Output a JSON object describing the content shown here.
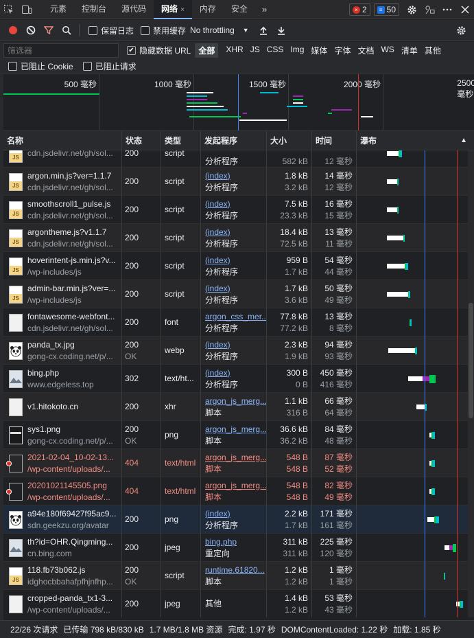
{
  "tabs": [
    {
      "label": "元素"
    },
    {
      "label": "控制台"
    },
    {
      "label": "源代码"
    },
    {
      "label": "网络",
      "active": true
    },
    {
      "label": "内存"
    },
    {
      "label": "安全"
    }
  ],
  "tab_close": "×",
  "more_tabs": "»",
  "errors_count": "2",
  "messages_count": "50",
  "toolbar": {
    "preserve_log": "保留日志",
    "disable_cache": "禁用缓存",
    "throttling": "No throttling"
  },
  "filter": {
    "placeholder": "筛选器",
    "hide_data_urls": "隐藏数据 URL",
    "types": [
      "全部",
      "XHR",
      "JS",
      "CSS",
      "Img",
      "媒体",
      "字体",
      "文档",
      "WS",
      "清单",
      "其他"
    ],
    "blocked_cookies": "已阻止 Cookie",
    "blocked_requests": "已阻止请求"
  },
  "overview": {
    "labels": [
      "500 毫秒",
      "1000 毫秒",
      "1500 毫秒",
      "2000 毫秒",
      "2500 毫秒"
    ]
  },
  "columns": {
    "name": "名称",
    "status": "状态",
    "type": "类型",
    "initiator": "发起程序",
    "size": "大小",
    "time": "时间",
    "waterfall": "瀑布"
  },
  "requests": [
    {
      "name": "",
      "domain": "cdn.jsdelivr.net/gh/sol...",
      "status": "200",
      "status2": "",
      "type": "script",
      "initiator": "",
      "initiator2": "分析程序",
      "size": "",
      "size2": "582 kB",
      "time": "",
      "time2": "12 毫秒",
      "icon": "js",
      "wf_start": 0.26,
      "wf_wait": 0.1,
      "wf_dl": 0.03
    },
    {
      "name": "argon.min.js?ver=1.1.7",
      "domain": "cdn.jsdelivr.net/gh/sol...",
      "status": "200",
      "status2": "",
      "type": "script",
      "initiator": "(index)",
      "initiator2": "分析程序",
      "size": "1.8 kB",
      "size2": "3.2 kB",
      "time": "14 毫秒",
      "time2": "12 毫秒",
      "icon": "js",
      "wf_start": 0.26,
      "wf_wait": 0.09,
      "wf_dl": 0.01
    },
    {
      "name": "smoothscroll1_pulse.js",
      "domain": "cdn.jsdelivr.net/gh/sol...",
      "status": "200",
      "status2": "",
      "type": "script",
      "initiator": "(index)",
      "initiator2": "分析程序",
      "size": "7.5 kB",
      "size2": "23.3 kB",
      "time": "16 毫秒",
      "time2": "15 毫秒",
      "icon": "js",
      "wf_start": 0.26,
      "wf_wait": 0.09,
      "wf_dl": 0.01
    },
    {
      "name": "argontheme.js?v1.1.7",
      "domain": "cdn.jsdelivr.net/gh/sol...",
      "status": "200",
      "status2": "",
      "type": "script",
      "initiator": "(index)",
      "initiator2": "分析程序",
      "size": "18.4 kB",
      "size2": "72.5 kB",
      "time": "13 毫秒",
      "time2": "11 毫秒",
      "icon": "js",
      "wf_start": 0.26,
      "wf_wait": 0.14,
      "wf_dl": 0.01
    },
    {
      "name": "hoverintent-js.min.js?v...",
      "domain": "/wp-includes/js",
      "status": "200",
      "status2": "",
      "type": "script",
      "initiator": "(index)",
      "initiator2": "分析程序",
      "size": "959 B",
      "size2": "1.7 kB",
      "time": "54 毫秒",
      "time2": "44 毫秒",
      "icon": "js",
      "wf_start": 0.26,
      "wf_wait": 0.15,
      "wf_dl": 0.03
    },
    {
      "name": "admin-bar.min.js?ver=...",
      "domain": "/wp-includes/js",
      "status": "200",
      "status2": "",
      "type": "script",
      "initiator": "(index)",
      "initiator2": "分析程序",
      "size": "1.7 kB",
      "size2": "3.6 kB",
      "time": "50 毫秒",
      "time2": "49 毫秒",
      "icon": "js",
      "wf_start": 0.26,
      "wf_wait": 0.18,
      "wf_dl": 0.02
    },
    {
      "name": "fontawesome-webfont...",
      "domain": "cdn.jsdelivr.net/gh/sol...",
      "status": "200",
      "status2": "",
      "type": "font",
      "initiator": "argon_css_mer...",
      "initiator2": "分析程序",
      "size": "77.8 kB",
      "size2": "77.2 kB",
      "time": "13 毫秒",
      "time2": "8 毫秒",
      "icon": "blank",
      "wf_start": 0.45,
      "wf_wait": 0.0,
      "wf_dl": 0.02
    },
    {
      "name": "panda_tx.jpg",
      "domain": "gong-cx.coding.net/p/...",
      "status": "200",
      "status2": "OK",
      "type": "webp",
      "initiator": "(index)",
      "initiator2": "分析程序",
      "size": "2.3 kB",
      "size2": "1.9 kB",
      "time": "94 毫秒",
      "time2": "93 毫秒",
      "icon": "panda",
      "wf_start": 0.27,
      "wf_wait": 0.23,
      "wf_dl": 0.02
    },
    {
      "name": "bing.php",
      "domain": "www.edgeless.top",
      "status": "302",
      "status2": "",
      "type": "text/ht...",
      "initiator": "(index)",
      "initiator2": "分析程序",
      "size": "300 B",
      "size2": "0 B",
      "time": "450 毫秒",
      "time2": "416 毫秒",
      "icon": "img",
      "wf_start": 0.44,
      "wf_wait": 0.12,
      "wf_dl": 0.11
    },
    {
      "name": "v1.hitokoto.cn",
      "domain": "",
      "status": "200",
      "status2": "",
      "type": "xhr",
      "initiator": "argon_js_merg...",
      "initiator2": "脚本",
      "size": "1.1 kB",
      "size2": "316 B",
      "time": "66 毫秒",
      "time2": "64 毫秒",
      "icon": "blank",
      "wf_start": 0.51,
      "wf_wait": 0.07,
      "wf_dl": 0.02
    },
    {
      "name": "sys1.png",
      "domain": "gong-cx.coding.net/p/...",
      "status": "200",
      "status2": "OK",
      "type": "png",
      "initiator": "argon_js_merg...",
      "initiator2": "脚本",
      "size": "36.6 kB",
      "size2": "36.2 kB",
      "time": "84 毫秒",
      "time2": "48 毫秒",
      "icon": "dark",
      "wf_start": 0.62,
      "wf_wait": 0.02,
      "wf_dl": 0.03
    },
    {
      "name": "2021-02-04_10-02-13...",
      "domain": "/wp-content/uploads/...",
      "status": "404",
      "status2": "",
      "type": "text/html",
      "initiator": "argon_js_merg...",
      "initiator2": "脚本",
      "size": "548 B",
      "size2": "548 B",
      "time": "87 毫秒",
      "time2": "52 毫秒",
      "icon": "err",
      "error": true,
      "wf_start": 0.62,
      "wf_wait": 0.02,
      "wf_dl": 0.03
    },
    {
      "name": "20201021145505.png",
      "domain": "/wp-content/uploads/...",
      "status": "404",
      "status2": "",
      "type": "text/html",
      "initiator": "argon_js_merg...",
      "initiator2": "脚本",
      "size": "548 B",
      "size2": "548 B",
      "time": "82 毫秒",
      "time2": "49 毫秒",
      "icon": "err",
      "error": true,
      "wf_start": 0.62,
      "wf_wait": 0.02,
      "wf_dl": 0.03
    },
    {
      "name": "a94e180f69427f95ac9...",
      "domain": "sdn.geekzu.org/avatar",
      "status": "200",
      "status2": "",
      "type": "png",
      "initiator": "(index)",
      "initiator2": "分析程序",
      "size": "2.2 kB",
      "size2": "1.7 kB",
      "time": "171 毫秒",
      "time2": "161 毫秒",
      "icon": "panda",
      "selected": true,
      "wf_start": 0.6,
      "wf_wait": 0.06,
      "wf_dl": 0.04
    },
    {
      "name": "th?id=OHR.Qingming...",
      "domain": "cn.bing.com",
      "status": "200",
      "status2": "",
      "type": "jpeg",
      "initiator": "bing.php",
      "initiator2": "重定向",
      "size": "311 kB",
      "size2": "311 kB",
      "time": "225 毫秒",
      "time2": "120 毫秒",
      "icon": "img",
      "wf_start": 0.75,
      "wf_wait": 0.04,
      "wf_dl": 0.06
    },
    {
      "name": "118.fb73b062.js",
      "domain": "idghocbbahafpfhjnfhp...",
      "status": "200",
      "status2": "OK",
      "type": "script",
      "initiator": "runtime.61820...",
      "initiator2": "脚本",
      "size": "1.2 kB",
      "size2": "1.2 kB",
      "time": "1 毫秒",
      "time2": "1 毫秒",
      "icon": "js",
      "wf_start": 0.74,
      "wf_wait": 0.0,
      "wf_dl": 0.01
    },
    {
      "name": "cropped-panda_tx1-3...",
      "domain": "/wp-content/uploads/...",
      "status": "200",
      "status2": "",
      "type": "jpeg",
      "initiator": "其他",
      "initiator2": "",
      "size": "1.4 kB",
      "size2": "1.2 kB",
      "time": "53 毫秒",
      "time2": "43 毫秒",
      "icon": "blank",
      "wf_start": 0.85,
      "wf_wait": 0.03,
      "wf_dl": 0.03
    }
  ],
  "status_bar": {
    "requests": "22/26 次请求",
    "transferred": "已传输 798 kB/830 kB",
    "resources": "1.7 MB/1.8 MB 资源",
    "finish": "完成: 1.97 秒",
    "dcl": "DOMContentLoaded: 1.22 秒",
    "load": "加载: 1.85 秒"
  },
  "colors": {
    "accent": "#8ab4f8",
    "error": "#f28b82",
    "record": "#e8453c",
    "filter": "#f28b82",
    "dcl_line": "#4285f4",
    "load_line": "#d93025",
    "wait": "#ffffff",
    "download": "#00bcd4",
    "queue": "#9c27b0",
    "receive": "#00c853"
  }
}
